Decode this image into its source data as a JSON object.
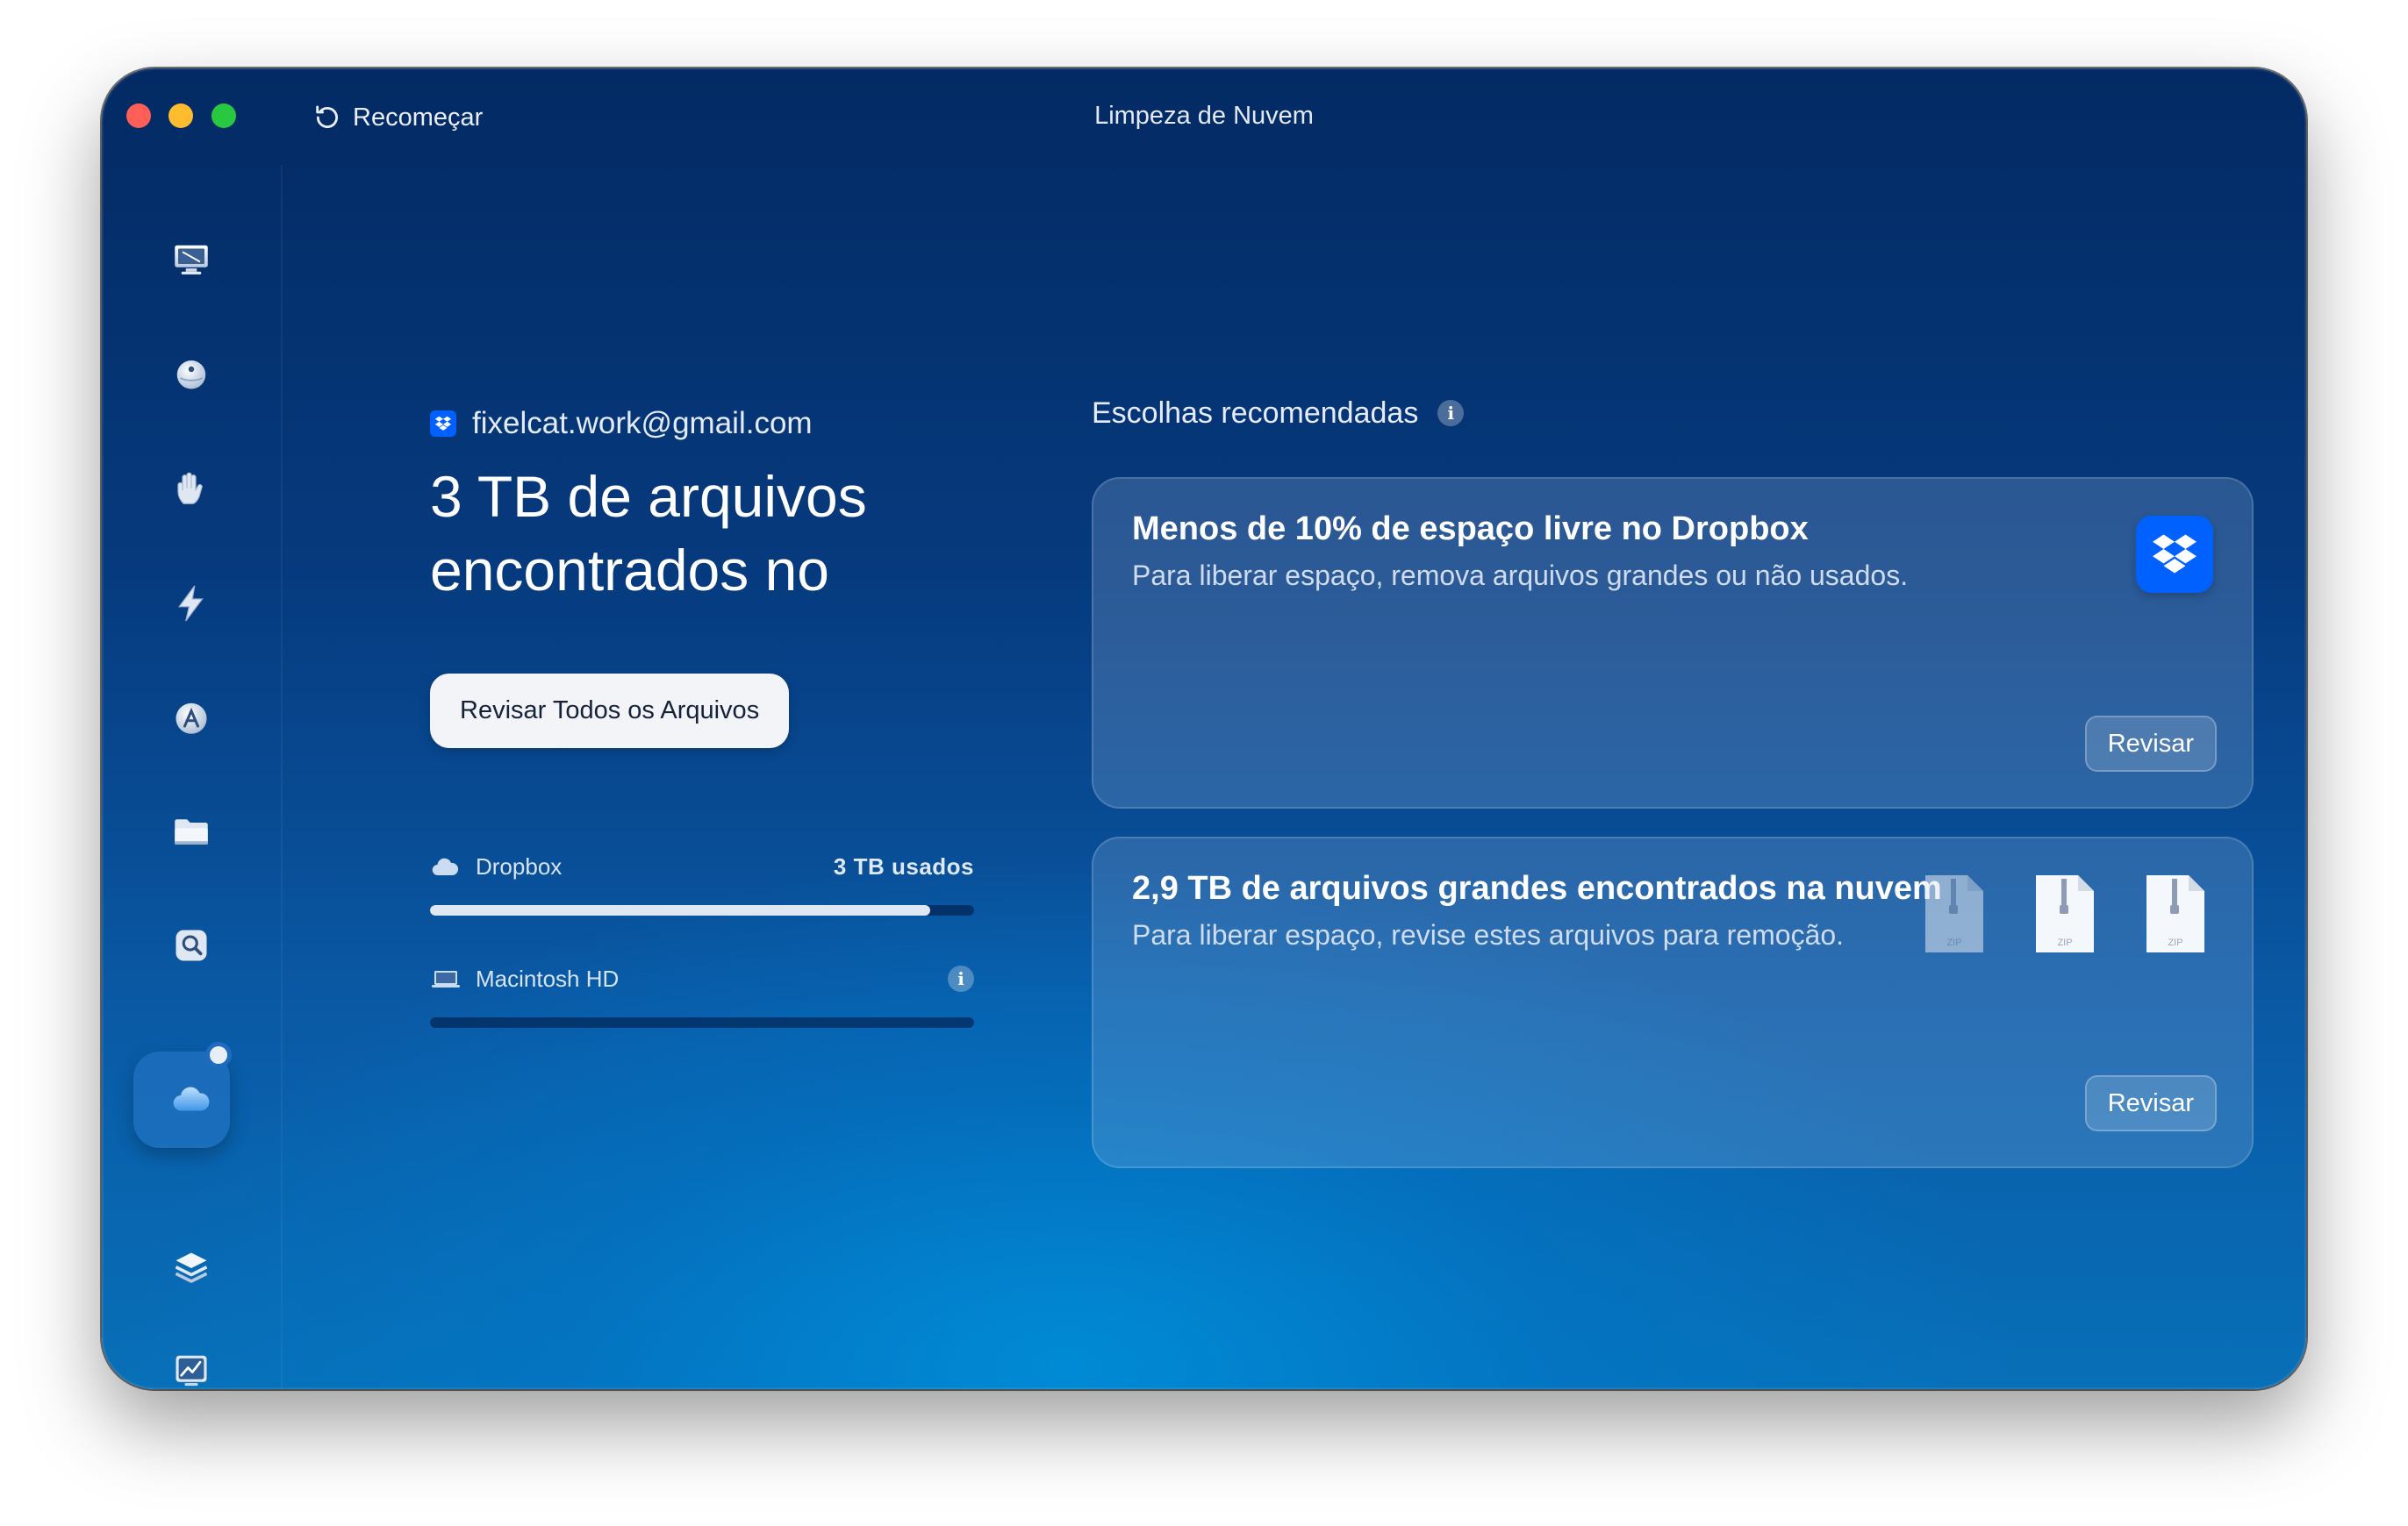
{
  "window": {
    "title": "Limpeza de Nuvem",
    "restart_label": "Recomeçar"
  },
  "sidebar": {
    "items": [
      {
        "name": "smart-scan",
        "icon": "monitor-icon"
      },
      {
        "name": "cleanup",
        "icon": "ball-icon"
      },
      {
        "name": "protection",
        "icon": "hand-icon"
      },
      {
        "name": "performance",
        "icon": "bolt-icon"
      },
      {
        "name": "applications",
        "icon": "apps-icon"
      },
      {
        "name": "my-clutter",
        "icon": "folder-icon"
      },
      {
        "name": "space-lens",
        "icon": "lens-icon"
      },
      {
        "name": "cloud-cleanup",
        "icon": "cloud-icon",
        "active": true
      },
      {
        "name": "shredder",
        "icon": "layers-icon"
      },
      {
        "name": "menu",
        "icon": "chart-icon"
      }
    ]
  },
  "account": {
    "email": "fixelcat.work@gmail.com",
    "headline": "3 TB de arquivos encontrados no",
    "review_all": "Revisar Todos os Arquivos"
  },
  "storage": [
    {
      "name": "Dropbox",
      "used": "3 TB usados",
      "fill": 0.92
    },
    {
      "name": "Macintosh HD",
      "used": "",
      "fill": 0
    }
  ],
  "recommendations": {
    "title": "Escolhas recomendadas",
    "cards": [
      {
        "title": "Menos de 10% de espaço livre no Dropbox",
        "desc": "Para liberar espaço, remova arquivos grandes ou não usados.",
        "action": "Revisar"
      },
      {
        "title": "2,9 TB de arquivos grandes encontrados na nuvem",
        "desc": "Para liberar espaço, revise estes arquivos para remoção.",
        "action": "Revisar",
        "file_label": "ZIP"
      }
    ]
  },
  "colors": {
    "accent": "#0061fe",
    "bg_top": "#032a63",
    "bg_bottom": "#0870b8"
  }
}
